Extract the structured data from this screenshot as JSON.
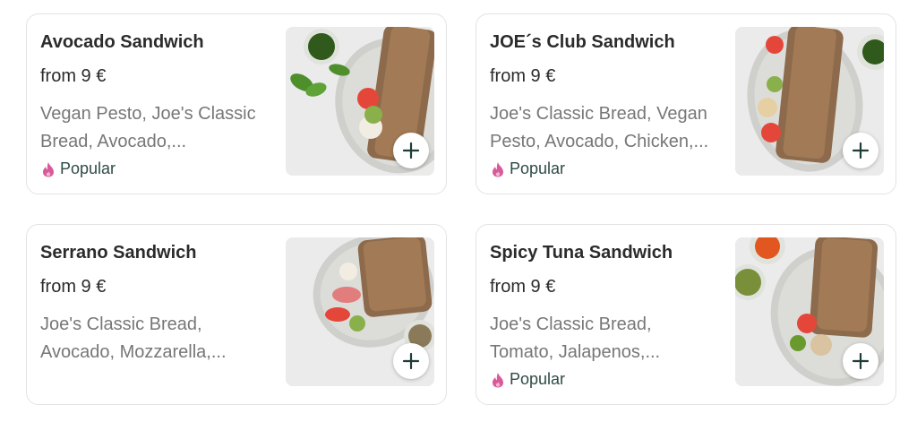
{
  "products": [
    {
      "name": "Avocado Sandwich",
      "price": "from 9 €",
      "description": "Vegan Pesto, Joe's Classic Bread, Avocado,...",
      "badge": "Popular"
    },
    {
      "name": "JOE´s Club Sandwich",
      "price": "from 9 €",
      "description": "Joe's Classic Bread, Vegan Pesto, Avocado, Chicken,...",
      "badge": "Popular"
    },
    {
      "name": "Serrano Sandwich",
      "price": "from 9 €",
      "description": "Joe's Classic Bread, Avocado, Mozzarella,..."
    },
    {
      "name": "Spicy Tuna Sandwich",
      "price": "from 9 €",
      "description": "Joe's Classic Bread, Tomato, Jalapenos,...",
      "badge": "Popular"
    }
  ],
  "icons": {
    "add": "plus-icon",
    "popular": "flame-icon"
  },
  "colors": {
    "badge_flame": "#d95a9a",
    "badge_text": "#2f4b45",
    "plus": "#1f3d36"
  }
}
